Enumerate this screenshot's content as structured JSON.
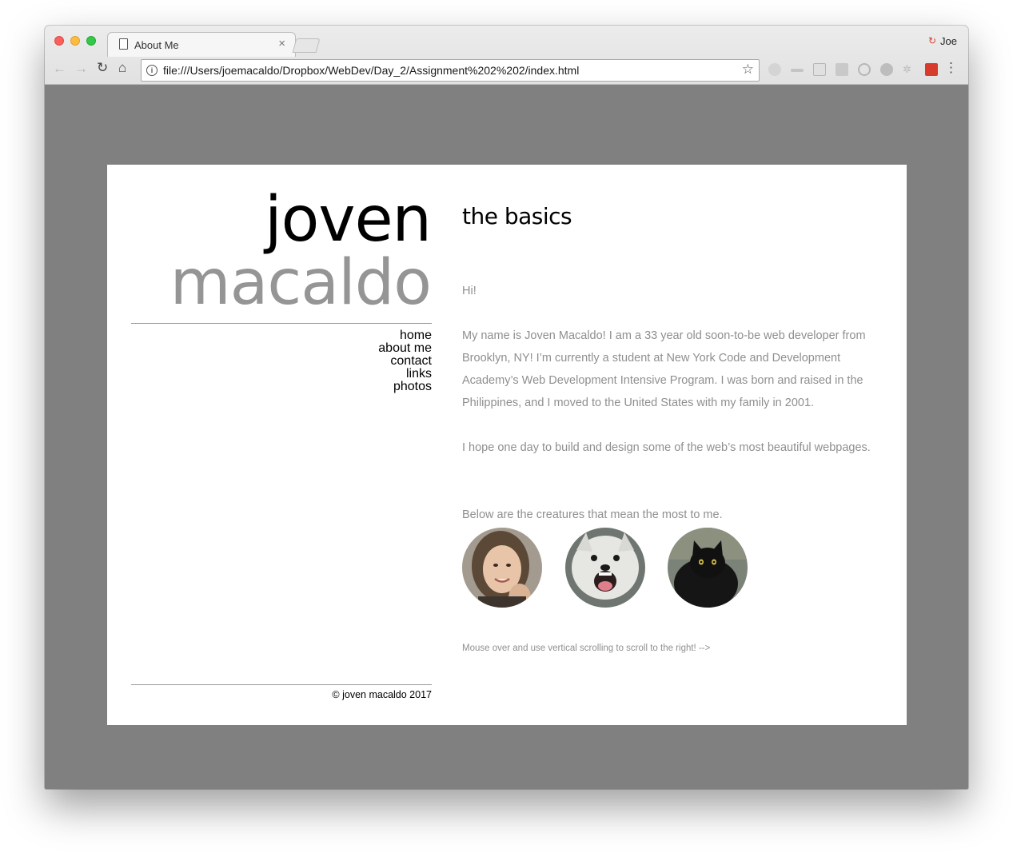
{
  "browser": {
    "tab_title": "About Me",
    "tab_close": "×",
    "profile_name": "Joe",
    "url": "file:///Users/joemacaldo/Dropbox/WebDev/Day_2/Assignment%202%202/index.html",
    "nav_back": "←",
    "nav_forward": "→",
    "nav_reload": "↻",
    "nav_home": "⌂",
    "info": "i",
    "star": "☆",
    "menu": "⋮",
    "colors": {
      "page_background": "#808080",
      "chrome": "#e6e6e6"
    }
  },
  "sidebar": {
    "first_name": "joven",
    "last_name": "macaldo",
    "nav": [
      "home",
      "about me",
      "contact",
      "links",
      "photos"
    ],
    "copyright": "© joven macaldo 2017"
  },
  "main": {
    "title": "the basics",
    "greeting": "Hi!",
    "bio": "My name is Joven Macaldo! I am a 33 year old soon-to-be web developer from Brooklyn, NY! I’m currently a student at New York Code and Development Academy’s Web Development Intensive Program. I was born and raised in the Philippines, and I moved to the United States with my family in 2001.",
    "hope": "I hope one day to build and design some of the web’s most beautiful webpages.",
    "creatures_intro": "Below are the creatures that mean the most to me.",
    "creatures": [
      "woman-photo",
      "dog-photo",
      "cat-photo"
    ],
    "scroll_hint": "Mouse over and use vertical scrolling to scroll to the right! -->"
  }
}
